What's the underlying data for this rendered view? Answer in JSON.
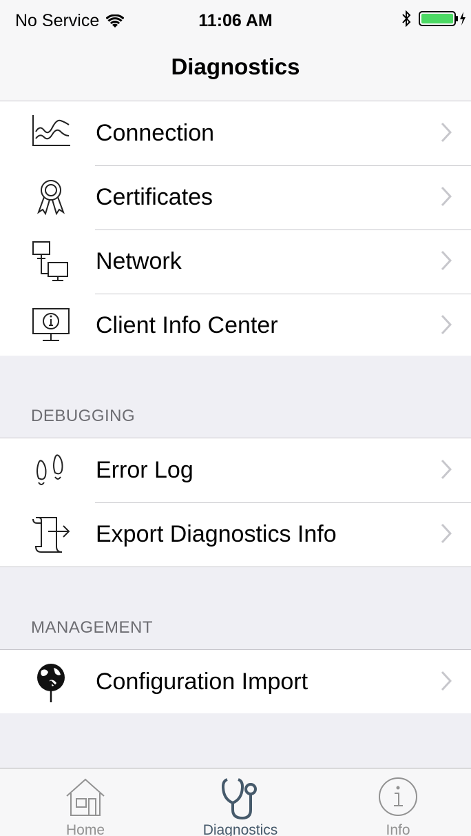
{
  "status_bar": {
    "carrier": "No Service",
    "time": "11:06 AM"
  },
  "nav": {
    "title": "Diagnostics"
  },
  "main_rows": [
    {
      "label": "Connection",
      "icon": "connection-graph-icon"
    },
    {
      "label": "Certificates",
      "icon": "certificate-ribbon-icon"
    },
    {
      "label": "Network",
      "icon": "network-computers-icon"
    },
    {
      "label": "Client Info Center",
      "icon": "monitor-info-icon"
    }
  ],
  "debugging": {
    "header": "DEBUGGING",
    "rows": [
      {
        "label": "Error Log",
        "icon": "footprints-icon"
      },
      {
        "label": "Export Diagnostics Info",
        "icon": "scroll-export-icon"
      }
    ]
  },
  "management": {
    "header": "MANAGEMENT",
    "rows": [
      {
        "label": "Configuration Import",
        "icon": "globe-upload-icon"
      }
    ]
  },
  "tab_bar": {
    "tabs": [
      {
        "label": "Home",
        "icon": "home-icon"
      },
      {
        "label": "Diagnostics",
        "icon": "stethoscope-icon",
        "active": true
      },
      {
        "label": "Info",
        "icon": "info-circle-icon"
      }
    ]
  },
  "colors": {
    "accent": "#465a6b",
    "battery": "#4cd964",
    "separator": "#c8c7cc",
    "group_bg": "#efeff4"
  }
}
